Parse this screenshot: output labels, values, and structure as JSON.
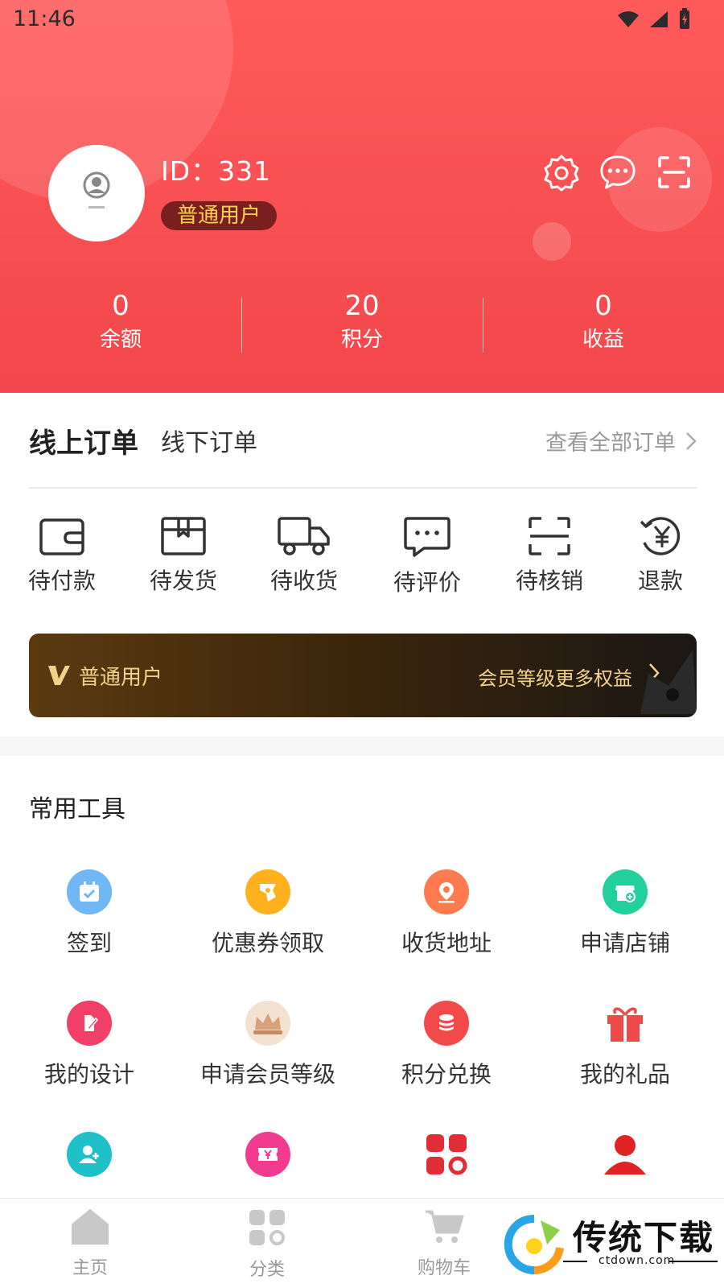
{
  "status_bar": {
    "time": "11:46"
  },
  "profile": {
    "id_label": "ID：331",
    "badge": "普通用户"
  },
  "header_actions": [
    "settings",
    "messages",
    "scan"
  ],
  "stats": [
    {
      "value": "0",
      "label": "余额"
    },
    {
      "value": "20",
      "label": "积分"
    },
    {
      "value": "0",
      "label": "收益"
    }
  ],
  "orders": {
    "tab_online": "线上订单",
    "tab_offline": "线下订单",
    "view_all": "查看全部订单",
    "items": [
      {
        "label": "待付款",
        "icon": "wallet-icon"
      },
      {
        "label": "待发货",
        "icon": "box-icon"
      },
      {
        "label": "待收货",
        "icon": "truck-icon"
      },
      {
        "label": "待评价",
        "icon": "comment-icon"
      },
      {
        "label": "待核销",
        "icon": "scan-icon"
      },
      {
        "label": "退款",
        "icon": "refund-icon"
      }
    ]
  },
  "member": {
    "name": "普通用户",
    "more": "会员等级更多权益"
  },
  "tools": {
    "title": "常用工具",
    "items": [
      {
        "label": "签到",
        "icon": "calendar-check-icon",
        "color": "#6fb8f5"
      },
      {
        "label": "优惠券领取",
        "icon": "coupon-icon",
        "color": "#ffb21e"
      },
      {
        "label": "收货地址",
        "icon": "location-icon",
        "color": "#ff7a4f"
      },
      {
        "label": "申请店铺",
        "icon": "store-icon",
        "color": "#23cf9a"
      },
      {
        "label": "我的设计",
        "icon": "design-icon",
        "color": "#f0406a"
      },
      {
        "label": "申请会员等级",
        "icon": "crown-icon",
        "color": "#d7a27a"
      },
      {
        "label": "积分兑换",
        "icon": "points-icon",
        "color": "#f24a4a"
      },
      {
        "label": "我的礼品",
        "icon": "gift-icon",
        "color": "#ef4a4a"
      },
      {
        "label": "",
        "icon": "user-add-icon",
        "color": "#1fc1c9"
      },
      {
        "label": "",
        "icon": "yen-ticket-icon",
        "color": "#f03b8f"
      },
      {
        "label": "",
        "icon": "grid-icon",
        "color": "#e02d36"
      },
      {
        "label": "",
        "icon": "person-icon",
        "color": "#e02222"
      }
    ]
  },
  "bottom_nav": [
    {
      "label": "主页",
      "icon": "home-icon"
    },
    {
      "label": "分类",
      "icon": "category-icon"
    },
    {
      "label": "购物车",
      "icon": "cart-icon"
    }
  ],
  "watermark": {
    "title": "传统下载",
    "sub": "ctdown.com"
  },
  "colors": {
    "primary": "#f2474c",
    "accent_gold": "#f2d28a",
    "text": "#333333"
  }
}
